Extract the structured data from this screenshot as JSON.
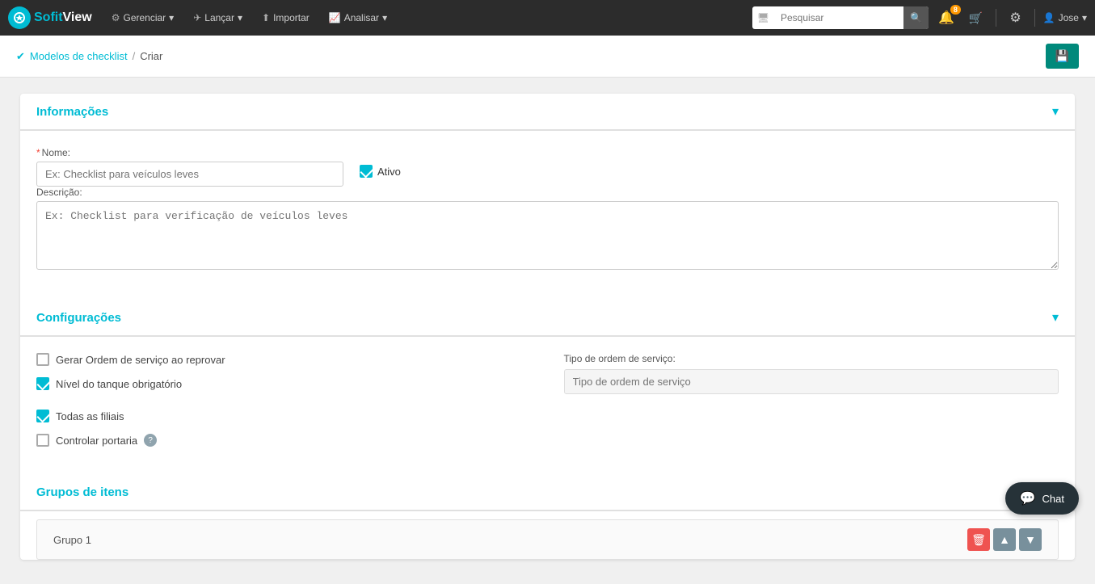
{
  "app": {
    "logo_sofit": "Sofit",
    "logo_view": "View"
  },
  "topnav": {
    "items": [
      {
        "id": "gerenciar",
        "label": "Gerenciar",
        "icon": "⚙"
      },
      {
        "id": "lancar",
        "label": "Lançar",
        "icon": "✈"
      },
      {
        "id": "importar",
        "label": "Importar",
        "icon": "⬆"
      },
      {
        "id": "analisar",
        "label": "Analisar",
        "icon": "📈"
      }
    ],
    "search_placeholder": "Pesquisar",
    "notification_badge": "8",
    "user_name": "Jose"
  },
  "breadcrumb": {
    "parent_label": "Modelos de checklist",
    "separator": "/",
    "current": "Criar"
  },
  "save_button": {
    "icon": "💾",
    "label": ""
  },
  "section_informacoes": {
    "title": "Informações",
    "fields": {
      "nome_label": "Nome:",
      "nome_required": "*",
      "nome_placeholder": "Ex: Checklist para veículos leves",
      "ativo_label": "Ativo",
      "descricao_label": "Descrição:",
      "descricao_placeholder": "Ex: Checklist para verificação de veículos leves"
    }
  },
  "section_configuracoes": {
    "title": "Configurações",
    "checkboxes": [
      {
        "id": "gerar_ordem",
        "label": "Gerar Ordem de serviço ao reprovar",
        "checked": false
      },
      {
        "id": "nivel_tanque",
        "label": "Nível do tanque obrigatório",
        "checked": true
      },
      {
        "id": "todas_filiais",
        "label": "Todas as filiais",
        "checked": true
      },
      {
        "id": "controlar_portaria",
        "label": "Controlar portaria",
        "checked": false,
        "has_help": true
      }
    ],
    "tipo_os_label": "Tipo de ordem de serviço:",
    "tipo_os_placeholder": "Tipo de ordem de serviço"
  },
  "section_grupos": {
    "title": "Grupos de itens",
    "grupo": {
      "name": "Grupo 1"
    }
  },
  "chat": {
    "label": "Chat"
  }
}
